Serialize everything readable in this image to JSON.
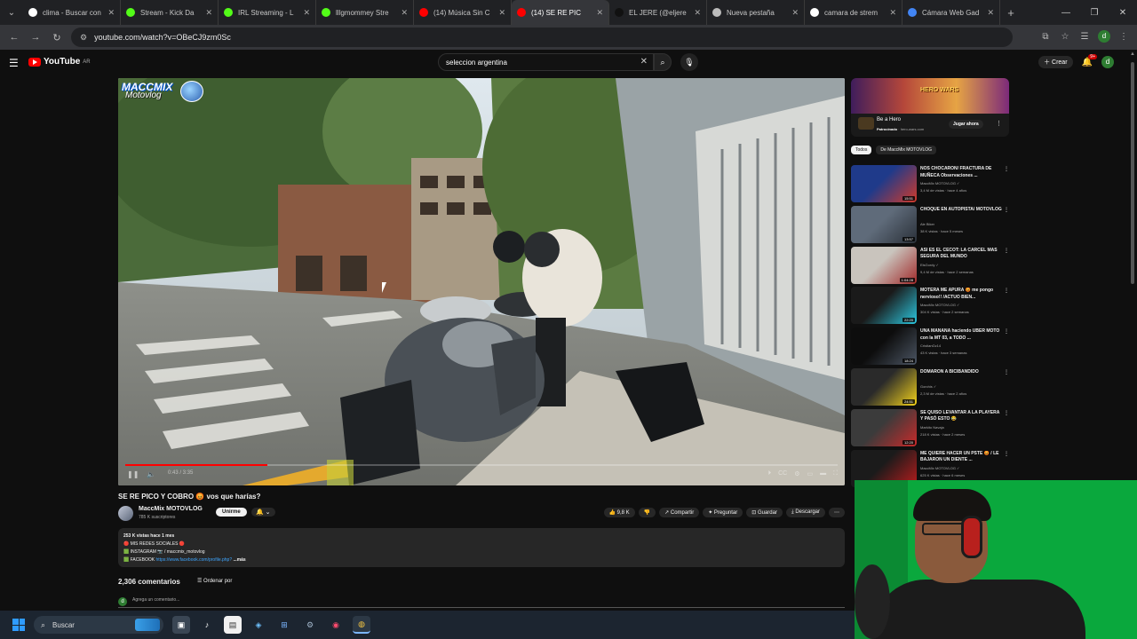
{
  "browser": {
    "tabs": [
      {
        "title": "clima - Buscar con",
        "color": "#ffffff",
        "active": false
      },
      {
        "title": "Stream - Kick Da",
        "color": "#53fc18",
        "active": false
      },
      {
        "title": "IRL Streaming - L",
        "color": "#53fc18",
        "active": false
      },
      {
        "title": "lllgmommey Stre",
        "color": "#53fc18",
        "active": false
      },
      {
        "title": "(14) Música Sin C",
        "color": "#ff0000",
        "active": false
      },
      {
        "title": "(14) SE RE PIC",
        "color": "#ff0000",
        "active": true
      },
      {
        "title": "EL JERE (@eljere",
        "color": "#111111",
        "active": false
      },
      {
        "title": "Nueva pestaña",
        "color": "#bbbbbb",
        "active": false
      },
      {
        "title": "camara de strem",
        "color": "#ffffff",
        "active": false
      },
      {
        "title": "Cámara Web Gad",
        "color": "#4285f4",
        "active": false
      }
    ],
    "url": "youtube.com/watch?v=OBeCJ9zm0Sc"
  },
  "youtube": {
    "logo": "YouTube",
    "country_code": "AR",
    "search_value": "seleccion argentina",
    "create_label": "Crear",
    "notif_count": "9+",
    "avatar_letter": "d"
  },
  "video": {
    "watermark_line1": "MACCMIX",
    "watermark_line2": "Motovlog",
    "time": "0:43 / 3:35",
    "progress": 0.2
  },
  "meta": {
    "title": "SE RE PICO Y COBRO 😡 vos que harías?",
    "channel": "MaccMix MOTOVLOG",
    "subs": "785 K suscriptores",
    "join_label": "Unirme",
    "likes": "9,8 K",
    "share": "Compartir",
    "ask": "Preguntar",
    "save": "Guardar",
    "download": "Descargar"
  },
  "description": {
    "stats": "253 K vistas  hace 1 mes",
    "line1": "🔴 MIS REDES SOCIALES 🔴",
    "line2": "🟩 INSTAGRAM",
    "line2b": "📷 / maccmix_motovlog",
    "line3": "🟩 FACEBOOK",
    "fb_link": "https://www.facebook.com/profile.php?",
    "more": "...más"
  },
  "comments": {
    "count": "2,306 comentarios",
    "sort": "Ordenar por",
    "placeholder": "Agrega un comentario..."
  },
  "ad": {
    "brand": "HERO WARS",
    "title": "Be a Hero",
    "sponsored": "Patrocinado",
    "domain": "· hero-wars.com",
    "cta": "Jugar ahora"
  },
  "chips": [
    "Todos",
    "De MaccMix MOTOVLOG"
  ],
  "recommendations": [
    {
      "title": "NOS CHOCARON/ FRACTURA DE MUÑECA Observaciones ...",
      "channel": "MaccMix MOTOVLOG ✓",
      "views": "3,4 M de vistas · hace 4 años",
      "dur": "15:51",
      "c1": "#1f3a8a",
      "c2": "#d13a2a"
    },
    {
      "title": "CHOQUE EN AUTOPISTA/ MOTOVLOG",
      "channel": "Ale Biker",
      "views": "38 K vistas · hace 5 meses",
      "dur": "13:57",
      "c1": "#5f6b7a",
      "c2": "#2a3038"
    },
    {
      "title": "ASÍ ES EL CECOT: LA CÁRCEL MÁS SEGURA DEL MUNDO",
      "channel": "ElsGordy ✓",
      "views": "9,4 M de vistas · hace 2 semanas",
      "dur": "1:04:28",
      "c1": "#c9c4bd",
      "c2": "#a12a2a"
    },
    {
      "title": "MOTERA ME APURA 😡 me pongo nervioso!! /ACTUO BIEN...",
      "channel": "MaccMix MOTOVLOG ✓",
      "views": "304 K vistas · hace 2 semanas",
      "dur": "22:20",
      "c1": "#1a1a1a",
      "c2": "#2cc8e0"
    },
    {
      "title": "UNA MAÑANA haciendo UBER MOTO con la MT 03, a TODO ...",
      "channel": "CristianGz14",
      "views": "43 K vistas · hace 3 semanas",
      "dur": "18:24",
      "c1": "#0d0d0d",
      "c2": "#4b5563"
    },
    {
      "title": "DOMARON A BICIBANDIDO",
      "channel": "Gorchis ✓",
      "views": "2,3 M de vistas · hace 2 años",
      "dur": "24:51",
      "c1": "#2a2a2a",
      "c2": "#f3d21b"
    },
    {
      "title": "SE QUISO LEVANTAR A LA PLAYERA Y PASÓ ESTO 😂",
      "channel": "Markito Navaja",
      "views": "218 K vistas · hace 2 meses",
      "dur": "12:20",
      "c1": "#3b3b3b",
      "c2": "#c92a2a"
    },
    {
      "title": "ME QUIERE HACER UN PSTE 😡 / LE BAJARON UN DIENTE ...",
      "channel": "MaccMix MOTOVLOG ✓",
      "views": "625 K vistas · hace 6 meses",
      "dur": "20:11",
      "c1": "#1b1b1b",
      "c2": "#b91c1c"
    }
  ],
  "taskbar": {
    "search_label": "Buscar"
  }
}
